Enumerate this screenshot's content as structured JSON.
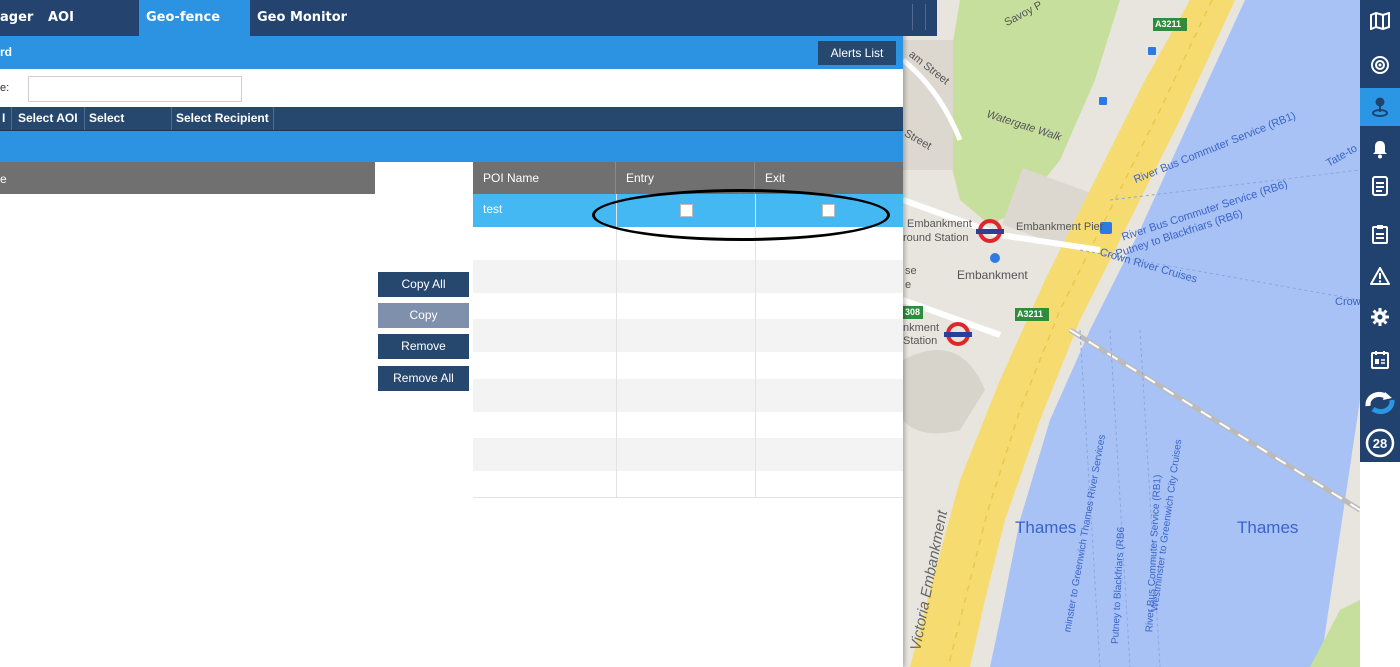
{
  "tabs": [
    {
      "label": "ager"
    },
    {
      "label": "AOI Manager"
    },
    {
      "label": "Geo-fence Alert",
      "active": true
    },
    {
      "label": "Geo Monitor"
    }
  ],
  "header": {
    "title": "rd",
    "alerts_list_label": "Alerts List"
  },
  "name_field": {
    "label": "e:",
    "value": ""
  },
  "subtabs": [
    {
      "label": "I"
    },
    {
      "label": "Select AOI"
    },
    {
      "label": "Select Vehicle"
    },
    {
      "label": "Select Recipient"
    }
  ],
  "left_grid": {
    "header": "e"
  },
  "actions": {
    "copy_all": "Copy All",
    "copy": "Copy",
    "remove": "Remove",
    "remove_all": "Remove All"
  },
  "poi_grid": {
    "columns": [
      "POI Name",
      "Entry",
      "Exit"
    ],
    "rows": [
      {
        "name": "test",
        "entry": false,
        "exit": false,
        "selected": true
      }
    ]
  },
  "map": {
    "labels": {
      "savoy": "Savoy P",
      "a3211_top": "A3211",
      "am_street": "am Street",
      "street": "Street",
      "watergate": "Watergate Walk",
      "rb1": "River Bus Commuter Service (RB1)",
      "tate": "Tate-to",
      "embankment_station": "Embankment",
      "round_station": "round Station",
      "embankment_pier": "Embankment Pier",
      "rb6_top": "River Bus Commuter Service (RB6)",
      "putney": "Putney to Blackfriars (RB6)",
      "crown": "Crown River Cruises",
      "crow": "Crow",
      "se": "se",
      "e": "e",
      "embankment": "Embankment",
      "n308": "308",
      "a3211_mid": "A3211",
      "nkment": "nkment",
      "station": "Station",
      "thames_left": "Thames",
      "thames_right": "Thames",
      "victoria": "Victoria Embankment",
      "wgreen1": "minster to Greenwich Thames River Services",
      "putney2": "Putney to Blackfriars (RB6",
      "rb1_v": "River Bus Commuter Service (RB1)",
      "wcity": "Westminster to Greenwich City Cruises",
      "minster_bottom": "minster to Greenwich"
    }
  },
  "toolbar": {
    "items": [
      "map-icon",
      "target-icon",
      "geofence-pin-icon",
      "bell-icon",
      "report-icon",
      "clipboard-icon",
      "warning-icon",
      "settings-icon",
      "calendar-id-icon",
      "refresh-icon"
    ],
    "badge": "28"
  },
  "colors": {
    "nav": "#24446f",
    "accent": "#2c93e2",
    "selected_row": "#43b8f3",
    "water": "#a9c3f8",
    "park": "#c5df9b",
    "road": "#f4d965"
  }
}
